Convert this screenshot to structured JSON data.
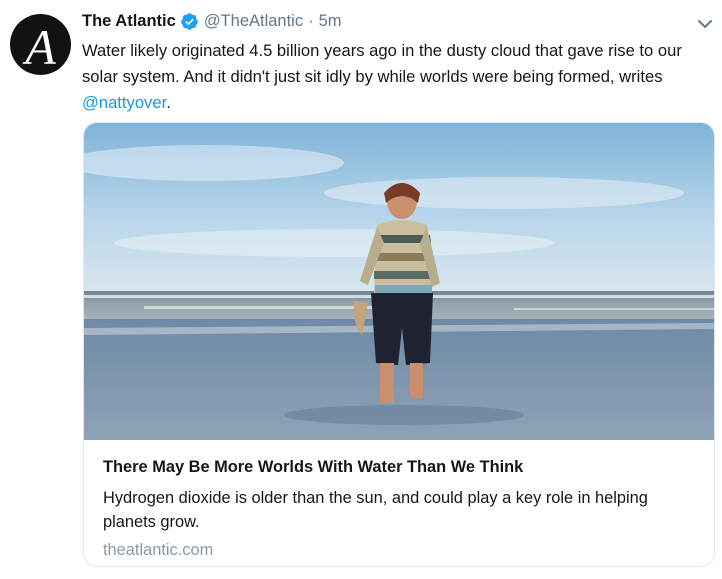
{
  "author": {
    "display_name": "The Atlantic",
    "avatar_letter": "A",
    "handle": "@TheAtlantic",
    "separator": "·",
    "time_ago": "5m"
  },
  "tweet": {
    "text": "Water likely originated 4.5 billion years ago in the dusty cloud that gave rise to our solar system. And it didn't just sit idly by while worlds were being formed, writes ",
    "mention": "@nattyover",
    "text_end": "."
  },
  "card": {
    "title": "There May Be More Worlds With Water Than We Think",
    "description": "Hydrogen dioxide is older than the sun, and could play a key role in helping planets grow.",
    "domain": "theatlantic.com"
  },
  "icons": {
    "verified": "verified-badge-icon",
    "caret": "chevron-down-icon"
  },
  "colors": {
    "link": "#1b95e0",
    "verified": "#1da1f2",
    "muted": "#657786"
  }
}
